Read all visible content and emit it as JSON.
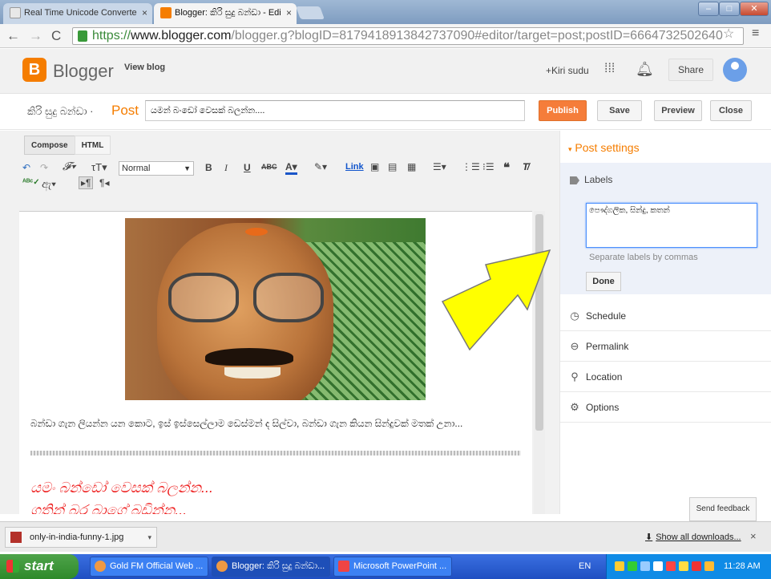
{
  "browser": {
    "tabs": [
      {
        "label": "Real Time Unicode Converte",
        "close": "×"
      },
      {
        "label": "Blogger: කිරි සුදු බන්ඩා - Edi",
        "close": "×"
      }
    ],
    "url": {
      "scheme": "https://",
      "domain": "www.blogger.com",
      "path": "/blogger.g?blogID=8179418913842737090#editor/target=post;postID=6664732502640"
    },
    "nav_icons": [
      "back-icon",
      "forward-icon",
      "reload-icon",
      "star-icon",
      "menu-icon"
    ]
  },
  "blogger": {
    "logo_letter": "B",
    "brand": "Blogger",
    "view_blog": "View blog",
    "user": "+Kiri sudu",
    "share": "Share",
    "brand_color": "#f57d00"
  },
  "post": {
    "blog_title": "කිරි සුදු බන්ඩා",
    "separator": "·",
    "post_tag": "Post",
    "title_value": "යමන් බංඩෝ වෙසක් බලන්න....",
    "buttons": {
      "publish": "Publish",
      "save": "Save",
      "preview": "Preview",
      "close": "Close"
    }
  },
  "editor": {
    "mode_tabs": [
      "Compose",
      "HTML"
    ],
    "font_select": "Normal",
    "link_label": "Link",
    "paragraph": "බන්ඩා ගැන ලියන්න යන කොට, ඉස් ඉස්සෙල්ලාම ඩෙස්මන් ද සිල්වා, බන්ඩා ගැන කියන සින්දුවක් මතක් උනා...",
    "red_line_1": "යමං බන්ඩෝ වෙසක් බලන්න...",
    "red_line_2": "ගතින් බර බාගේ බඩින්න..."
  },
  "sidebar": {
    "post_settings": "Post settings",
    "labels": {
      "title": "Labels",
      "value": "පෞද්ගලික, සින්දු, කතන්",
      "hint": "Separate labels by commas",
      "done": "Done"
    },
    "items": [
      {
        "label": "Schedule",
        "icon": "clock-icon",
        "glyph": "◷"
      },
      {
        "label": "Permalink",
        "icon": "link-icon",
        "glyph": "⊖"
      },
      {
        "label": "Location",
        "icon": "pin-icon",
        "glyph": "⚲"
      },
      {
        "label": "Options",
        "icon": "gear-icon",
        "glyph": "⚙"
      }
    ],
    "feedback": "Send feedback"
  },
  "downloads": {
    "file": "only-in-india-funny-1.jpg",
    "show_all": "Show all downloads...",
    "close": "×"
  },
  "taskbar": {
    "start": "start",
    "items": [
      "Gold FM Official Web ...",
      "Blogger: කිරි සුදු බන්ඩා...",
      "Microsoft PowerPoint ..."
    ],
    "lang": "EN",
    "clock": "11:28 AM"
  },
  "annotation_arrow_color": "#ffff00"
}
